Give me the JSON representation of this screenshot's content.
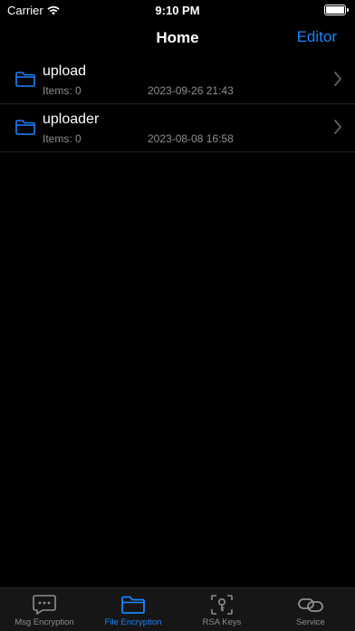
{
  "status": {
    "carrier": "Carrier",
    "time": "9:10 PM",
    "battery_level": 1.0
  },
  "nav": {
    "title": "Home",
    "action_label": "Editor"
  },
  "files": [
    {
      "name": "upload",
      "items": "Items: 0",
      "date": "2023-09-26 21:43"
    },
    {
      "name": "uploader",
      "items": "Items: 0",
      "date": "2023-08-08 16:58"
    }
  ],
  "icons": {
    "row": "folder-icon",
    "row_chevron": "chevron-right-icon"
  },
  "tabs": [
    {
      "label": "Msg Encryption",
      "icon": "message-icon",
      "active": false
    },
    {
      "label": "File Encryption",
      "icon": "folder-icon",
      "active": true
    },
    {
      "label": "RSA Keys",
      "icon": "key-icon",
      "active": false
    },
    {
      "label": "Service",
      "icon": "link-icon",
      "active": false
    }
  ],
  "colors": {
    "accent": "#1a84ff",
    "background": "#000000",
    "secondary_text": "#8e8e93",
    "tab_bar": "#161616"
  }
}
